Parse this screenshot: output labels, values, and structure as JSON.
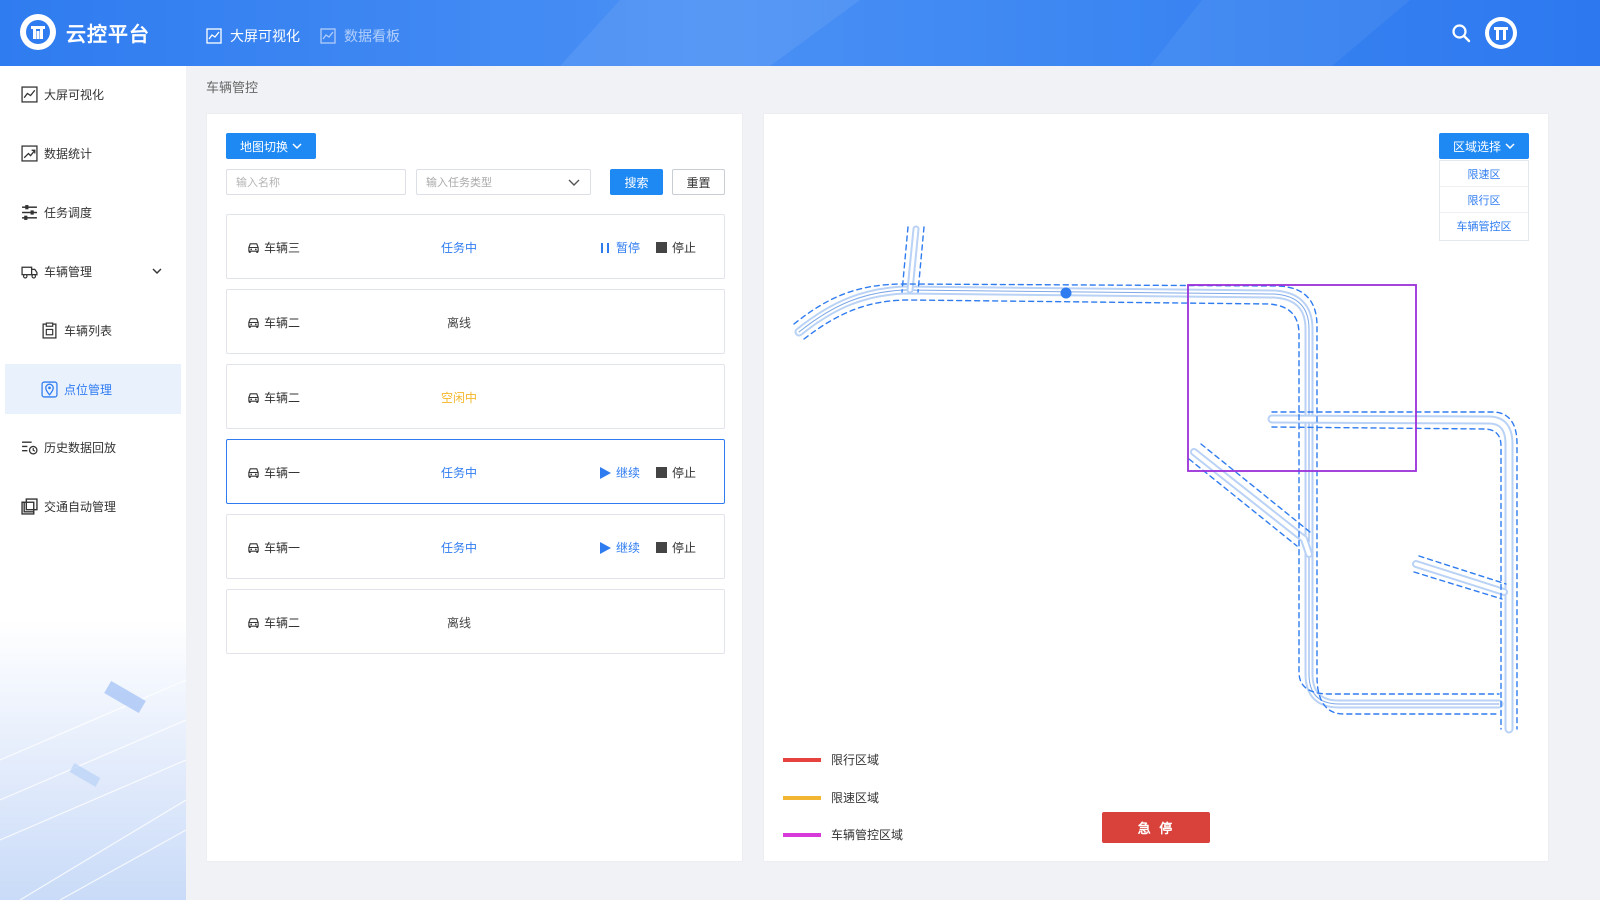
{
  "header": {
    "brand": "云控平台",
    "nav": [
      {
        "label": "大屏可视化"
      },
      {
        "label": "数据看板"
      }
    ]
  },
  "sidebar": {
    "items": [
      {
        "label": "大屏可视化",
        "icon": "chart-line-icon"
      },
      {
        "label": "数据统计",
        "icon": "trend-chart-icon"
      },
      {
        "label": "任务调度",
        "icon": "sliders-icon"
      },
      {
        "label": "车辆管理",
        "icon": "truck-icon"
      },
      {
        "label": "车辆列表",
        "icon": "clipboard-icon"
      },
      {
        "label": "点位管理",
        "icon": "map-pin-icon"
      },
      {
        "label": "历史数据回放",
        "icon": "history-list-icon"
      },
      {
        "label": "交通自动管理",
        "icon": "copy-stack-icon"
      }
    ]
  },
  "breadcrumb": "车辆管控",
  "toolbar": {
    "map_switch": "地图切换",
    "name_placeholder": "输入名称",
    "type_placeholder": "输入任务类型",
    "search": "搜索",
    "reset": "重置"
  },
  "vehicles": [
    {
      "name": "车辆三",
      "status": "任务中",
      "status_color": "#2f7cf0",
      "action": "暂停",
      "stop": "停止"
    },
    {
      "name": "车辆二",
      "status": "离线",
      "status_color": "#444444"
    },
    {
      "name": "车辆二",
      "status": "空闲中",
      "status_color": "#f5b72b"
    },
    {
      "name": "车辆一",
      "status": "任务中",
      "status_color": "#2f7cf0",
      "action": "继续",
      "stop": "停止",
      "selected": true
    },
    {
      "name": "车辆一",
      "status": "任务中",
      "status_color": "#2f7cf0",
      "action": "继续",
      "stop": "停止"
    },
    {
      "name": "车辆二",
      "status": "离线",
      "status_color": "#444444"
    }
  ],
  "map": {
    "zone_select": "区域选择",
    "zone_options": [
      "限速区",
      "限行区",
      "车辆管控区"
    ],
    "legend": [
      {
        "label": "限行区域",
        "color": "#e8423f"
      },
      {
        "label": "限速区域",
        "color": "#f2b632"
      },
      {
        "label": "车辆管控区域",
        "color": "#d63ad9"
      }
    ],
    "control_zone_color": "#9b30d9",
    "emergency_stop": "急 停"
  }
}
